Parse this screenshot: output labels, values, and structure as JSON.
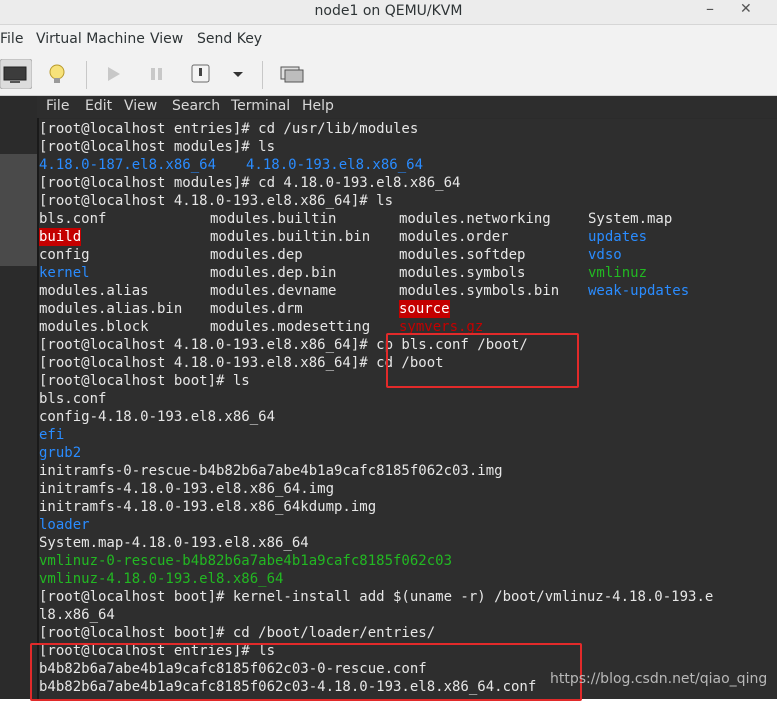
{
  "window": {
    "title": "node1 on QEMU/KVM",
    "minimize": "–",
    "close": "✕"
  },
  "menubar": [
    "File",
    "Virtual Machine",
    "View",
    "Send Key"
  ],
  "terminal_menu": [
    "File",
    "Edit",
    "View",
    "Search",
    "Terminal",
    "Help"
  ],
  "watermark": "https://blog.csdn.net/qiao_qing",
  "colors": {
    "dir_blue": "#2a8cff",
    "exec_green": "#22b822",
    "broken_red": "#c40000",
    "highlight": "#e22a2a"
  },
  "lines": [
    [
      {
        "t": "[root@localhost entries]# cd /usr/lib/modules",
        "c": ""
      }
    ],
    [
      {
        "t": "[root@localhost modules]# ls",
        "c": ""
      }
    ],
    [
      {
        "t": "4.18.0-187.el8.x86_64",
        "c": "blue"
      },
      {
        "t": "4.18.0-193.el8.x86_64",
        "c": "blue"
      }
    ],
    [
      {
        "t": "[root@localhost modules]# cd 4.18.0-193.el8.x86_64",
        "c": ""
      }
    ],
    [
      {
        "t": "[root@localhost 4.18.0-193.el8.x86_64]# ls",
        "c": ""
      }
    ],
    [
      {
        "t": "bls.conf",
        "c": ""
      },
      {
        "t": "modules.builtin",
        "c": ""
      },
      {
        "t": "modules.networking",
        "c": ""
      },
      {
        "t": "System.map",
        "c": ""
      }
    ],
    [
      {
        "t": "build",
        "c": "redbg"
      },
      {
        "t": "modules.builtin.bin",
        "c": ""
      },
      {
        "t": "modules.order",
        "c": ""
      },
      {
        "t": "updates",
        "c": "blue"
      }
    ],
    [
      {
        "t": "config",
        "c": ""
      },
      {
        "t": "modules.dep",
        "c": ""
      },
      {
        "t": "modules.softdep",
        "c": ""
      },
      {
        "t": "vdso",
        "c": "blue"
      }
    ],
    [
      {
        "t": "kernel",
        "c": "blue"
      },
      {
        "t": "modules.dep.bin",
        "c": ""
      },
      {
        "t": "modules.symbols",
        "c": ""
      },
      {
        "t": "vmlinuz",
        "c": "green"
      }
    ],
    [
      {
        "t": "modules.alias",
        "c": ""
      },
      {
        "t": "modules.devname",
        "c": ""
      },
      {
        "t": "modules.symbols.bin",
        "c": ""
      },
      {
        "t": "weak-updates",
        "c": "blue"
      }
    ],
    [
      {
        "t": "modules.alias.bin",
        "c": ""
      },
      {
        "t": "modules.drm",
        "c": ""
      },
      {
        "t": "source",
        "c": "redbg"
      }
    ],
    [
      {
        "t": "modules.block",
        "c": ""
      },
      {
        "t": "modules.modesetting",
        "c": ""
      },
      {
        "t": "symvers.gz",
        "c": "redtxt"
      }
    ],
    [
      {
        "t": "[root@localhost 4.18.0-193.el8.x86_64]# cp bls.conf /boot/",
        "c": ""
      }
    ],
    [
      {
        "t": "[root@localhost 4.18.0-193.el8.x86_64]# cd /boot",
        "c": ""
      }
    ],
    [
      {
        "t": "[root@localhost boot]# ls",
        "c": ""
      }
    ],
    [
      {
        "t": "bls.conf",
        "c": ""
      }
    ],
    [
      {
        "t": "config-4.18.0-193.el8.x86_64",
        "c": ""
      }
    ],
    [
      {
        "t": "efi",
        "c": "blue"
      }
    ],
    [
      {
        "t": "grub2",
        "c": "blue"
      }
    ],
    [
      {
        "t": "initramfs-0-rescue-b4b82b6a7abe4b1a9cafc8185f062c03.img",
        "c": ""
      }
    ],
    [
      {
        "t": "initramfs-4.18.0-193.el8.x86_64.img",
        "c": ""
      }
    ],
    [
      {
        "t": "initramfs-4.18.0-193.el8.x86_64kdump.img",
        "c": ""
      }
    ],
    [
      {
        "t": "loader",
        "c": "blue"
      }
    ],
    [
      {
        "t": "System.map-4.18.0-193.el8.x86_64",
        "c": ""
      }
    ],
    [
      {
        "t": "vmlinuz-0-rescue-b4b82b6a7abe4b1a9cafc8185f062c03",
        "c": "green"
      }
    ],
    [
      {
        "t": "vmlinuz-4.18.0-193.el8.x86_64",
        "c": "green"
      }
    ],
    [
      {
        "t": "[root@localhost boot]# kernel-install add $(uname -r) /boot/vmlinuz-4.18.0-193.e",
        "c": ""
      }
    ],
    [
      {
        "t": "l8.x86_64",
        "c": ""
      }
    ],
    [
      {
        "t": "[root@localhost boot]# cd /boot/loader/entries/",
        "c": ""
      }
    ],
    [
      {
        "t": "[root@localhost entries]# ls",
        "c": ""
      }
    ],
    [
      {
        "t": "b4b82b6a7abe4b1a9cafc8185f062c03-0-rescue.conf",
        "c": ""
      }
    ],
    [
      {
        "t": "b4b82b6a7abe4b1a9cafc8185f062c03-4.18.0-193.el8.x86_64.conf",
        "c": ""
      }
    ]
  ]
}
